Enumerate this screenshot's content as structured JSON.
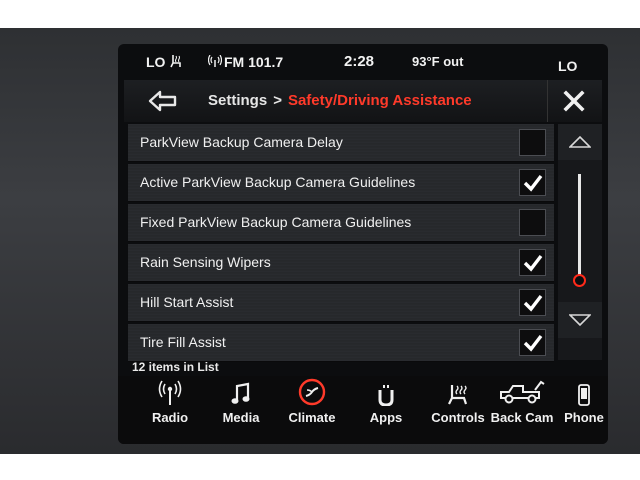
{
  "status_bar": {
    "climate_left": "LO",
    "radio_station": "FM 101.7",
    "time": "2:28",
    "outside_temp": "93°F out",
    "climate_right": "LO"
  },
  "header": {
    "breadcrumb_parent": "Settings",
    "breadcrumb_separator": ">",
    "breadcrumb_current": "Safety/Driving Assistance",
    "accent_color": "#ff3a2a"
  },
  "settings_list": {
    "items": [
      {
        "label": "ParkView Backup Camera Delay",
        "checked": false
      },
      {
        "label": "Active ParkView Backup Camera Guidelines",
        "checked": true
      },
      {
        "label": "Fixed ParkView Backup Camera Guidelines",
        "checked": false
      },
      {
        "label": "Rain Sensing Wipers",
        "checked": true
      },
      {
        "label": "Hill Start Assist",
        "checked": true
      },
      {
        "label": "Tire Fill Assist",
        "checked": true
      }
    ],
    "count_text": "12 items in List",
    "scroll_position": 0.9
  },
  "nav": {
    "items": [
      {
        "label": "Radio",
        "icon": "radio-antenna-icon"
      },
      {
        "label": "Media",
        "icon": "music-note-icon"
      },
      {
        "label": "Climate",
        "icon": "climate-fan-icon"
      },
      {
        "label": "Apps",
        "icon": "apps-icon"
      },
      {
        "label": "Controls",
        "icon": "heated-seat-icon"
      },
      {
        "label": "Back Cam",
        "icon": "truck-icon"
      },
      {
        "label": "Phone",
        "icon": "phone-icon"
      }
    ]
  }
}
